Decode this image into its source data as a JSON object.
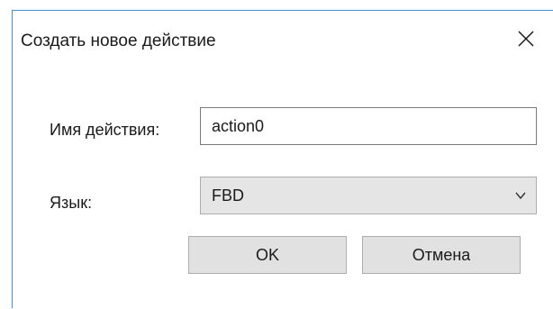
{
  "dialog": {
    "title": "Создать новое действие",
    "close_icon": "close-icon"
  },
  "form": {
    "name_label": "Имя действия:",
    "name_value": "action0",
    "language_label": "Язык:",
    "language_value": "FBD",
    "dropdown_icon": "chevron-down-icon"
  },
  "buttons": {
    "ok_label": "OK",
    "cancel_label": "Отмена"
  },
  "colors": {
    "window_border": "#4a90d9",
    "button_face": "#e1e1e1",
    "select_face": "#e5e5e5"
  }
}
